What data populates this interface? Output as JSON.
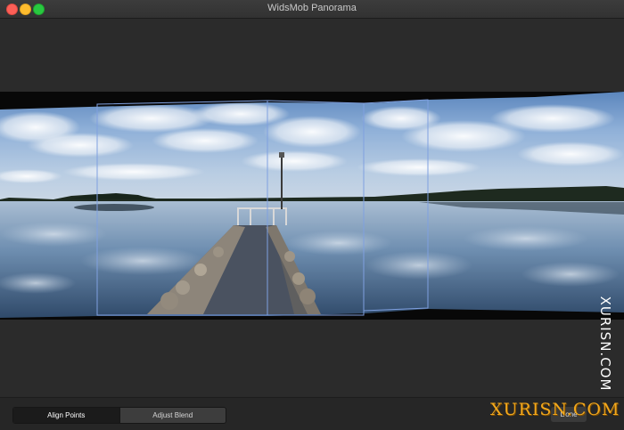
{
  "window": {
    "title": "WidsMob Panorama"
  },
  "toolbar": {
    "tabs": [
      {
        "label": "Align Points",
        "active": true
      },
      {
        "label": "Adjust Blend",
        "active": false
      }
    ],
    "done_label": "Done"
  },
  "watermark": {
    "vertical_text": "XURISN.COM",
    "logo_text": "XURISN.COM",
    "logo_color": "#f2a81d"
  },
  "colors": {
    "background": "#2a2a2a",
    "frame_lines": "#7fa0e0"
  },
  "panorama": {
    "frame_count": 5
  }
}
